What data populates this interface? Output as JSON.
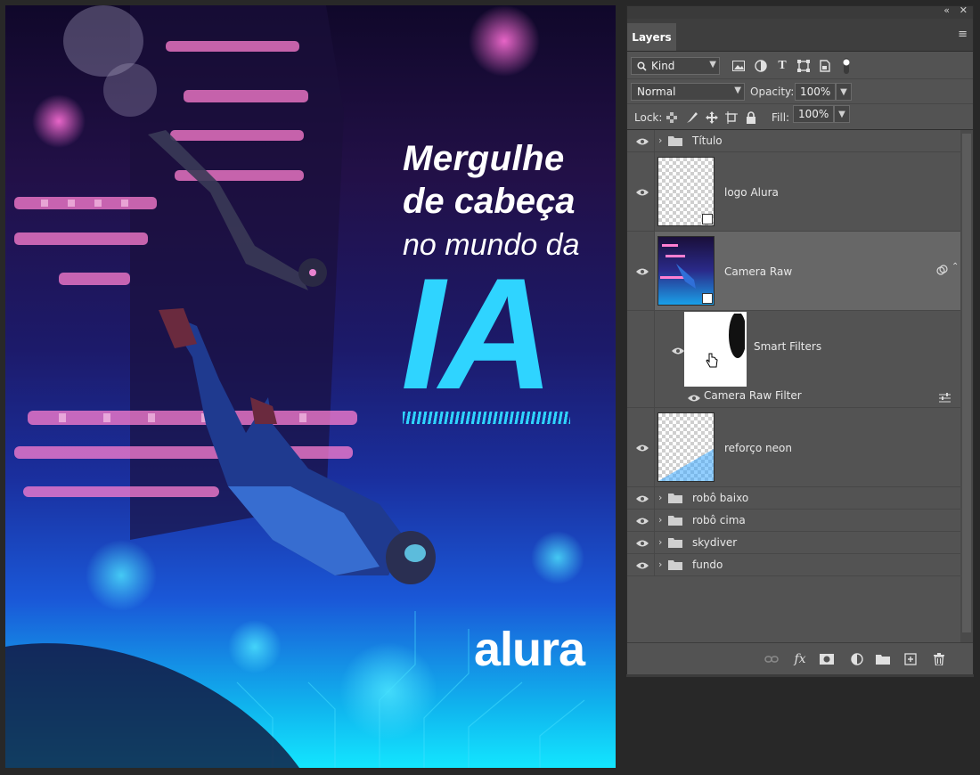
{
  "poster": {
    "line1": "Mergulhe",
    "line2": "de cabeça",
    "line3": "no mundo da",
    "big": "IA",
    "brand": "alura"
  },
  "panel": {
    "tab": "Layers",
    "filter_kind": "Kind",
    "blend_mode": "Normal",
    "opacity_label": "Opacity:",
    "opacity_value": "100%",
    "lock_label": "Lock:",
    "fill_label": "Fill:",
    "fill_value": "100%"
  },
  "layers": {
    "titulo": "Título",
    "logo": "logo Alura",
    "camera_raw": "Camera Raw",
    "smart_filters": "Smart Filters",
    "camera_raw_filter": "Camera Raw Filter",
    "reforco": "reforço neon",
    "robo_baixo": "robô baixo",
    "robo_cima": "robô cima",
    "skydiver": "skydiver",
    "fundo": "fundo"
  },
  "colors": {
    "accent_ia": "#2fd4ff",
    "panel_bg": "#535353",
    "selected_row": "#676767"
  }
}
